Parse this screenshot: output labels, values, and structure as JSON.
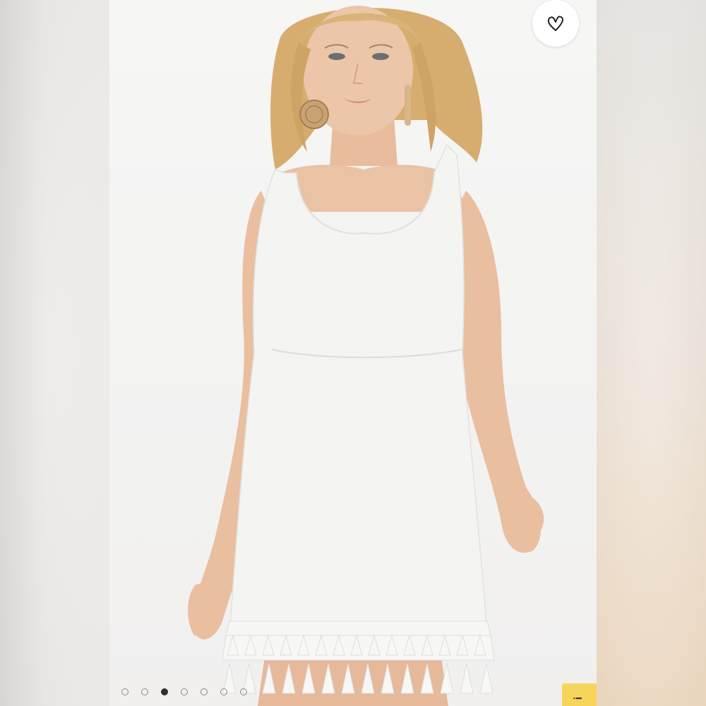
{
  "product_photo": {
    "alt": "",
    "slide_index": 3,
    "slide_count": 7
  },
  "favorite": {
    "icon": "heart-outline-icon"
  },
  "corner_badge": {
    "text": "i"
  },
  "colors": {
    "dress": "#f4f4f2",
    "hair": "#d9b47a",
    "skin": "#eac2a4",
    "badge": "#f7d55a"
  }
}
